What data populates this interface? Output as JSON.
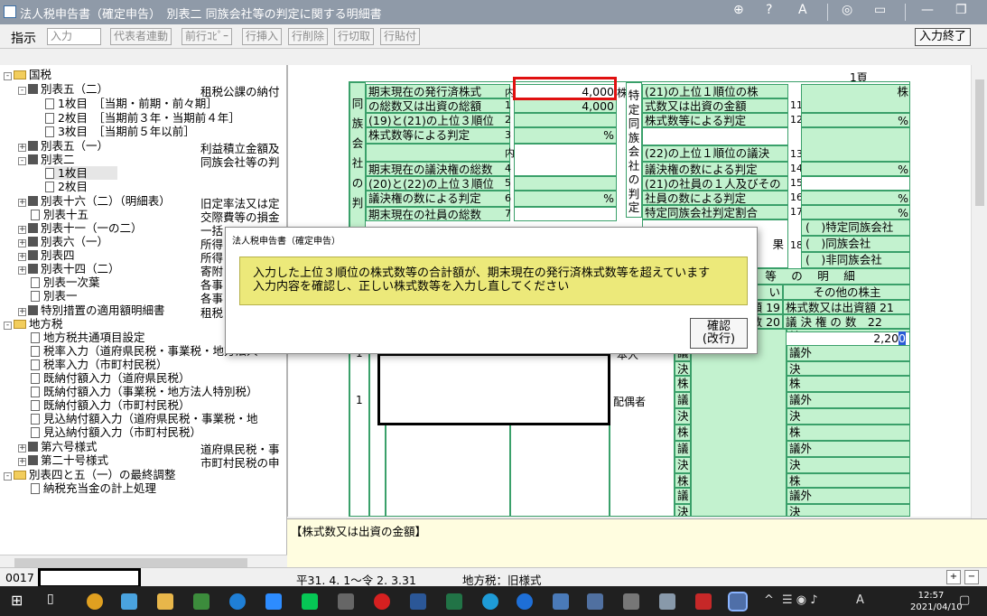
{
  "window": {
    "title": "法人税申告書（確定申告）　別表二 同族会社等の判定に関する明細書"
  },
  "toolbar": {
    "label": "指示",
    "input_value": "入力",
    "buttons": [
      "代表者連動",
      "前行ｺﾋﾟｰ",
      "行挿入",
      "行削除",
      "行切取",
      "行貼付"
    ],
    "end_label": "入力終了"
  },
  "tree": {
    "items": [
      {
        "text": "国税",
        "desc": ""
      },
      {
        "text": "別表五（二）",
        "desc": "租税公課の納付"
      },
      {
        "text": "1枚目　［当期・前期・前々期］",
        "desc": ""
      },
      {
        "text": "2枚目　［当期前３年・当期前４年］",
        "desc": ""
      },
      {
        "text": "3枚目　［当期前５年以前］",
        "desc": ""
      },
      {
        "text": "別表五（一）",
        "desc": "利益積立金額及"
      },
      {
        "text": "別表二",
        "desc": "同族会社等の判"
      },
      {
        "text": "1枚目",
        "desc": ""
      },
      {
        "text": "2枚目",
        "desc": ""
      },
      {
        "text": "別表十六（二）（明細表）",
        "desc": "旧定率法又は定"
      },
      {
        "text": "別表十五",
        "desc": "交際費等の損金"
      },
      {
        "text": "別表十一（一の二）",
        "desc": "一括"
      },
      {
        "text": "別表六（一）",
        "desc": "所得"
      },
      {
        "text": "別表四",
        "desc": "所得"
      },
      {
        "text": "別表十四（二）",
        "desc": "寄附"
      },
      {
        "text": "別表一次葉",
        "desc": "各事"
      },
      {
        "text": "別表一",
        "desc": "各事"
      },
      {
        "text": "特別措置の適用額明細書",
        "desc": "租税"
      },
      {
        "text": "地方税",
        "desc": ""
      },
      {
        "text": "地方税共通項目設定",
        "desc": ""
      },
      {
        "text": "税率入力（道府県民税・事業税・地方法人",
        "desc": ""
      },
      {
        "text": "税率入力（市町村民税）",
        "desc": ""
      },
      {
        "text": "既納付額入力（道府県民税）",
        "desc": ""
      },
      {
        "text": "既納付額入力（事業税・地方法人特別税）",
        "desc": ""
      },
      {
        "text": "既納付額入力（市町村民税）",
        "desc": ""
      },
      {
        "text": "見込納付額入力（道府県民税・事業税・地",
        "desc": ""
      },
      {
        "text": "見込納付額入力（市町村民税）",
        "desc": ""
      },
      {
        "text": "第六号様式",
        "desc": "道府県民税・事"
      },
      {
        "text": "第二十号様式",
        "desc": "市町村民税の申"
      },
      {
        "text": "別表四と五（一）の最終調整",
        "desc": ""
      },
      {
        "text": "納税充当金の計上処理",
        "desc": ""
      }
    ]
  },
  "form": {
    "page": "1頁",
    "rows_left": [
      {
        "label": "期末現在の発行済株式",
        "num": "内",
        "value": "4,000",
        "unit": "株"
      },
      {
        "label": "の総数又は出資の総額",
        "num": "1",
        "value": "4,000",
        "unit": ""
      },
      {
        "label": "(19)と(21)の上位３順位",
        "num": "2",
        "value": "",
        "unit": ""
      },
      {
        "label": "株式数等による判定",
        "num": "3",
        "value": "",
        "unit": "%"
      },
      {
        "label": "",
        "num": "内",
        "value": "",
        "unit": ""
      },
      {
        "label": "期末現在の議決権の総数",
        "num": "4",
        "value": "",
        "unit": ""
      },
      {
        "label": "(20)と(22)の上位３順位",
        "num": "5",
        "value": "",
        "unit": ""
      },
      {
        "label": "議決権の数による判定",
        "num": "6",
        "value": "",
        "unit": "%"
      },
      {
        "label": "期末現在の社員の総数",
        "num": "7",
        "value": "",
        "unit": ""
      }
    ],
    "rows_right": [
      {
        "label": "(21)の上位１順位の株",
        "num": "",
        "unit": "株"
      },
      {
        "label": "式数又は出資の金額",
        "num": "11",
        "unit": ""
      },
      {
        "label": "株式数等による判定",
        "num": "12",
        "unit": "%"
      },
      {
        "label": "",
        "num": "",
        "unit": ""
      },
      {
        "label": "(22)の上位１順位の議決",
        "num": "13",
        "unit": ""
      },
      {
        "label": "議決権の数による判定",
        "num": "14",
        "unit": "%"
      },
      {
        "label": "(21)の社員の１人及びその",
        "num": "15",
        "unit": ""
      },
      {
        "label": "社員の数による判定",
        "num": "16",
        "unit": "%"
      },
      {
        "label": "特定同族会社判定割合",
        "num": "17",
        "unit": "%"
      }
    ],
    "left_vertical": [
      "同",
      "族",
      "会",
      "社",
      "の",
      "判"
    ],
    "right_vertical": [
      "特",
      "定",
      "同",
      "族",
      "会",
      "社",
      "の",
      "判",
      "定"
    ],
    "judgment": {
      "label": "果",
      "num": "18",
      "options": [
        "(　)特定同族会社",
        "(　)同族会社",
        "(　)非同族会社"
      ]
    },
    "detail_header": "等　の　明　細",
    "other_holders_header": "その他の株主",
    "col_labels": [
      "い",
      "額 19",
      "株式数又は出資額 21",
      "数 20",
      "議 決 権 の 数　22"
    ],
    "input_value": "2,20",
    "lower_rows": [
      {
        "rank": "1",
        "rel": "本人",
        "kinds": [
          "株",
          "議",
          "決"
        ],
        "other": [
          "株",
          "議外",
          "決"
        ]
      },
      {
        "rank": "1",
        "rel": "配偶者",
        "kinds": [
          "株",
          "議",
          "決"
        ],
        "other": [
          "株",
          "議外",
          "決"
        ]
      },
      {
        "rank": "",
        "rel": "",
        "kinds": [
          "株",
          "議",
          "決"
        ],
        "other": [
          "株",
          "議外",
          "決"
        ]
      },
      {
        "rank": "",
        "rel": "",
        "kinds": [
          "株",
          "議",
          "決"
        ],
        "other": [
          "株",
          "議外",
          "決"
        ]
      }
    ]
  },
  "message_bar": {
    "text": "【株式数又は出資の金額】"
  },
  "dialog": {
    "title": "法人税申告書（確定申告）",
    "line1": "入力した上位３順位の株式数等の合計額が、期末現在の発行済株式数等を超えています",
    "line2": "入力内容を確認し、正しい株式数等を入力し直してください",
    "ok_line1": "確認",
    "ok_line2": "(改行)"
  },
  "status": {
    "code": "0017",
    "period": "平31. 4. 1～令 2. 3.31",
    "local_tax": "地方税：旧様式"
  },
  "taskbar": {
    "ime": "A",
    "time": "12:57",
    "date": "2021/04/10"
  }
}
